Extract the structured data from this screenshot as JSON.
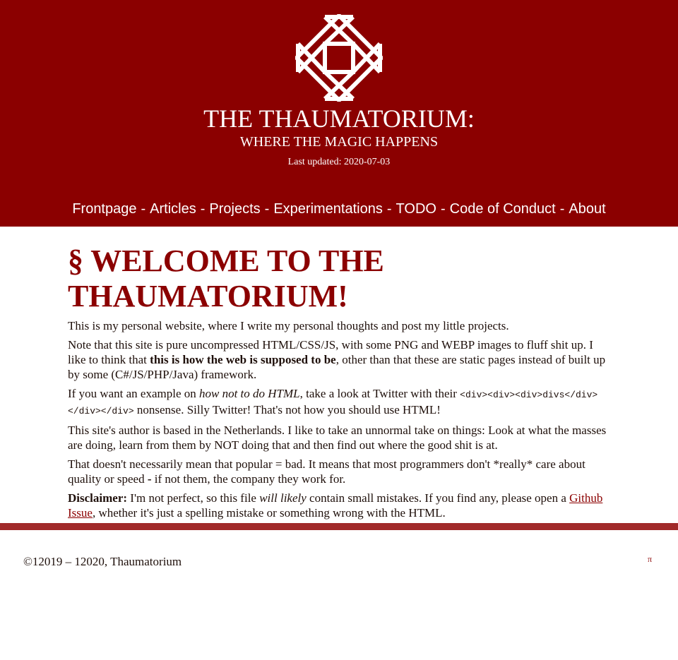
{
  "header": {
    "title": "THE THAUMATORIUM:",
    "subtitle": "WHERE THE MAGIC HAPPENS",
    "last_updated": "Last updated: 2020-07-03",
    "logo_color": "#ffffff",
    "background": "#8b0000",
    "logo_icon": "octagram-star-icon"
  },
  "nav": {
    "separator": "-",
    "items": [
      {
        "label": "Frontpage"
      },
      {
        "label": "Articles"
      },
      {
        "label": "Projects"
      },
      {
        "label": "Experimentations"
      },
      {
        "label": "TODO"
      },
      {
        "label": "Code of Conduct"
      },
      {
        "label": "About"
      }
    ]
  },
  "main": {
    "heading": "§ WELCOME TO THE THAUMATORIUM!",
    "p1": "This is my personal website, where I write my personal thoughts and post my little projects.",
    "p2": {
      "a": "Note that this site is pure uncompressed HTML/CSS/JS, with some PNG and WEBP images to fluff shit up. I like to think that ",
      "bold": "this is how the web is supposed to be",
      "b": ", other than that these are static pages instead of built up by some (C#/JS/PHP/Java) framework."
    },
    "p3": {
      "a": "If you want an example on ",
      "italic": "how not to do HTML",
      "b": ", take a look at Twitter with their ",
      "code": "<div><div><div>divs</div></div></div>",
      "c": " nonsense. Silly Twitter! That's not how you should use HTML!"
    },
    "p4": "This site's author is based in the Netherlands. I like to take an unnormal take on things: Look at what the masses are doing, learn from them by NOT doing that and then find out where the good shit is at.",
    "p5": {
      "a": "That doesn't necessarily mean that popular = bad. It means that most programmers don't *really* care about quality or speed ",
      "bold": "-",
      "b": " if not them, the company they work for."
    },
    "p6": {
      "bold": "Disclaimer:",
      "a": " I'm not perfect, so this file ",
      "italic": "will likely",
      "b": " contain small mistakes. If you find any, please open a ",
      "link": "Github Issue",
      "c": ", whether it's just a spelling mistake or something wrong with the HTML."
    }
  },
  "footer": {
    "copyright": "©12019 – 12020, Thaumatorium",
    "pi": "π"
  }
}
